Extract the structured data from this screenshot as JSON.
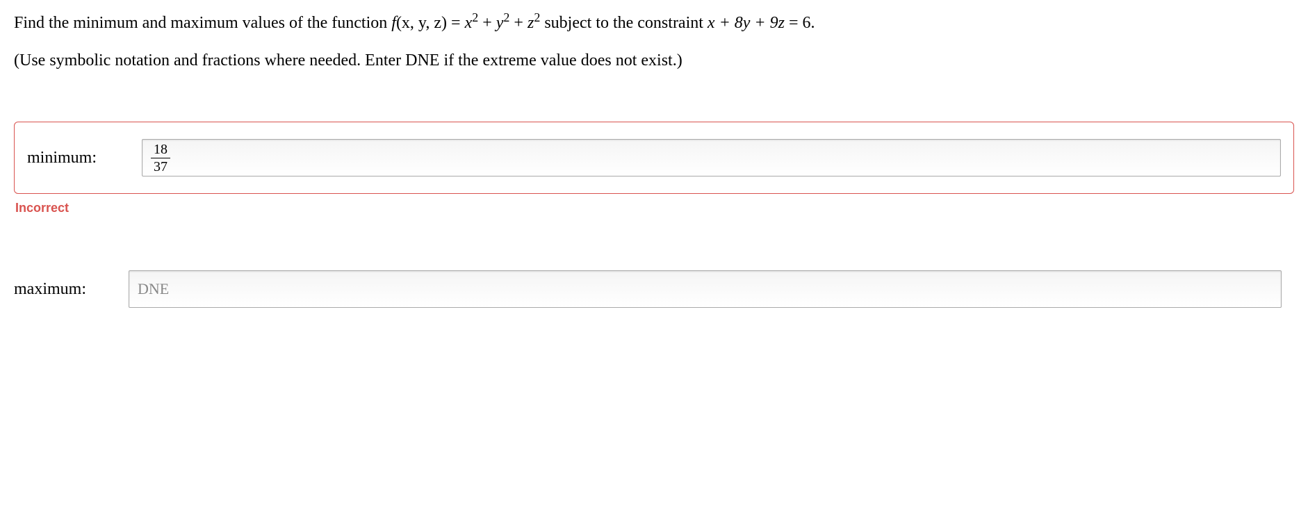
{
  "question": {
    "prefix": "Find the minimum and maximum values of the function ",
    "func_name": "f",
    "func_vars": "(x, y, z)",
    "equals": " = ",
    "expression_x": "x",
    "expression_plus1": " + ",
    "expression_y": "y",
    "expression_plus2": " + ",
    "expression_z": "z",
    "subject": " subject to the constraint ",
    "constraint_lhs": "x + 8y + 9z",
    "constraint_eq": " = 6."
  },
  "instruction": "(Use symbolic notation and fractions where needed. Enter DNE if the extreme value does not exist.)",
  "minimum": {
    "label": "minimum:",
    "value_num": "18",
    "value_den": "37",
    "feedback": "Incorrect"
  },
  "maximum": {
    "label": "maximum:",
    "placeholder": "DNE"
  }
}
